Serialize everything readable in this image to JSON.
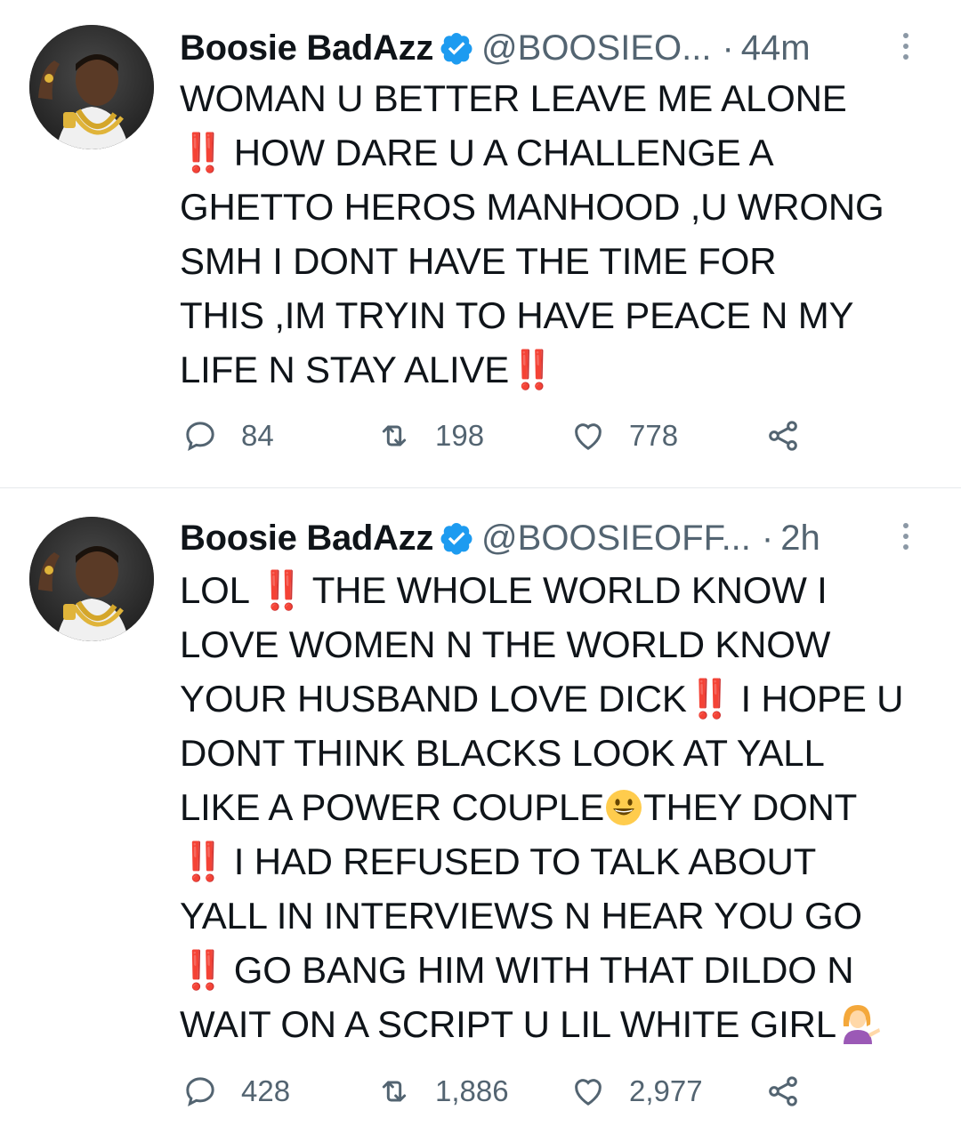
{
  "tweets": [
    {
      "name": "Boosie BadAzz",
      "handle": "@BOOSIEO...",
      "dot": "·",
      "time": "44m",
      "lines": [
        [
          "WOMAN U BETTER LEAVE ME ALONE"
        ],
        [
          "‼️",
          " HOW DARE U A CHALLENGE A"
        ],
        [
          "GHETTO HEROS MANHOOD ,U WRONG"
        ],
        [
          "SMH I DONT HAVE THE TIME FOR"
        ],
        [
          "THIS ,IM TRYIN TO HAVE PEACE N MY"
        ],
        [
          "LIFE N STAY ALIVE",
          "‼️"
        ]
      ],
      "replies": "84",
      "retweets": "198",
      "likes": "778"
    },
    {
      "name": "Boosie BadAzz",
      "handle": "@BOOSIEOFF...",
      "dot": "·",
      "time": "2h",
      "lines": [
        [
          "LOL ",
          "‼️",
          " THE WHOLE WORLD KNOW I"
        ],
        [
          "LOVE WOMEN N THE WORLD KNOW"
        ],
        [
          "YOUR HUSBAND LOVE DICK",
          "‼️",
          " I HOPE U"
        ],
        [
          "DONT THINK BLACKS LOOK AT YALL"
        ],
        [
          "LIKE A POWER COUPLE",
          "😃",
          "THEY DONT"
        ],
        [
          "‼️",
          " I HAD REFUSED TO TALK ABOUT"
        ],
        [
          "YALL IN INTERVIEWS N HEAR YOU GO"
        ],
        [
          "‼️",
          " GO BANG HIM WITH THAT DILDO N"
        ],
        [
          "WAIT ON A SCRIPT U LIL WHITE GIRL",
          "💁‍♀️"
        ]
      ],
      "replies": "428",
      "retweets": "1,886",
      "likes": "2,977"
    }
  ],
  "icons": {
    "verified": "verified-badge-icon",
    "more": "more-vertical-icon",
    "reply": "reply-icon",
    "retweet": "retweet-icon",
    "like": "heart-icon",
    "share": "share-icon"
  },
  "colors": {
    "verified_blue": "#1d9bf0",
    "text": "#0f1419",
    "secondary": "#536471",
    "emphasis_red": "#d0021b",
    "divider": "#e6e9ec"
  }
}
